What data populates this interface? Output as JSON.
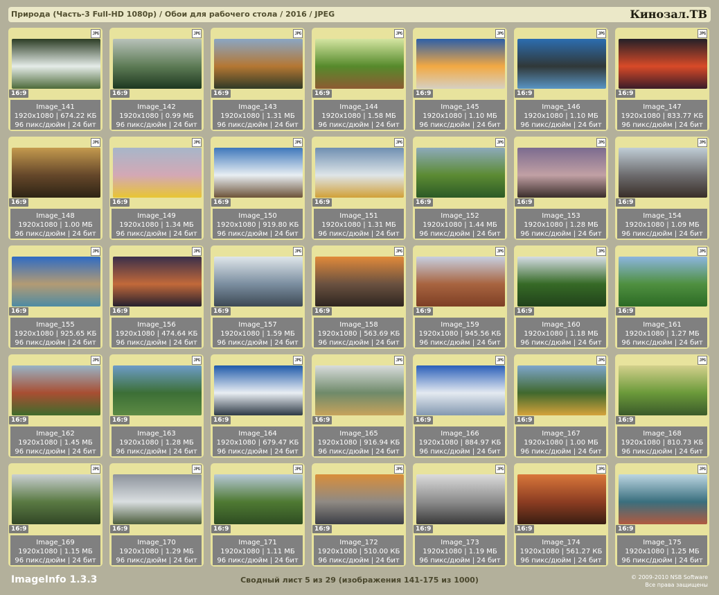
{
  "header": {
    "title": "Природа (Часть-3 Full-HD 1080p) / Обои для рабочего стола / 2016 / JPEG",
    "brand": "Кинозал.ТВ"
  },
  "card_badge": "JPG",
  "items": [
    {
      "name": "Image_141",
      "dims": "1920x1080 | 674.22 КБ",
      "meta": "96 пикс/дюйм | 24 бит",
      "ratio": "16:9",
      "colors": [
        "#2c3d25",
        "#e5ece8",
        "#4d6a3a"
      ]
    },
    {
      "name": "Image_142",
      "dims": "1920x1080 | 0.99 МБ",
      "meta": "96 пикс/дюйм | 24 бит",
      "ratio": "16:9",
      "colors": [
        "#b8c2ba",
        "#5d7b55",
        "#1d3820"
      ]
    },
    {
      "name": "Image_143",
      "dims": "1920x1080 | 1.31 МБ",
      "meta": "96 пикс/дюйм | 24 бит",
      "ratio": "16:9",
      "colors": [
        "#8aa6c4",
        "#b47733",
        "#303a26"
      ]
    },
    {
      "name": "Image_144",
      "dims": "1920x1080 | 1.58 МБ",
      "meta": "96 пикс/дюйм | 24 бит",
      "ratio": "16:9",
      "colors": [
        "#d4e5a1",
        "#568a2c",
        "#8d5b32"
      ]
    },
    {
      "name": "Image_145",
      "dims": "1920x1080 | 1.10 МБ",
      "meta": "96 пикс/дюйм | 24 бит",
      "ratio": "16:9",
      "colors": [
        "#2c5fa8",
        "#f2a943",
        "#d6d0c2"
      ]
    },
    {
      "name": "Image_146",
      "dims": "1920x1080 | 1.10 МБ",
      "meta": "96 пикс/дюйм | 24 бит",
      "ratio": "16:9",
      "colors": [
        "#2c6db0",
        "#303838",
        "#5995c4"
      ]
    },
    {
      "name": "Image_147",
      "dims": "1920x1080 | 833.77 КБ",
      "meta": "96 пикс/дюйм | 24 бит",
      "ratio": "16:9",
      "colors": [
        "#232028",
        "#d84a28",
        "#3a1c28"
      ]
    },
    {
      "name": "Image_148",
      "dims": "1920x1080 | 1.00 МБ",
      "meta": "96 пикс/дюйм | 24 бит",
      "ratio": "16:9",
      "colors": [
        "#c49a4e",
        "#65472a",
        "#2e2414"
      ]
    },
    {
      "name": "Image_149",
      "dims": "1920x1080 | 1.34 МБ",
      "meta": "96 пикс/дюйм | 24 бит",
      "ratio": "16:9",
      "colors": [
        "#a7b6c9",
        "#d3a8b5",
        "#e8c533"
      ]
    },
    {
      "name": "Image_150",
      "dims": "1920x1080 | 919.80 КБ",
      "meta": "96 пикс/дюйм | 24 бит",
      "ratio": "16:9",
      "colors": [
        "#3e78bb",
        "#e8eef3",
        "#6c5338"
      ]
    },
    {
      "name": "Image_151",
      "dims": "1920x1080 | 1.31 МБ",
      "meta": "96 пикс/дюйм | 24 бит",
      "ratio": "16:9",
      "colors": [
        "#6f8fb1",
        "#dee5e8",
        "#d1a038"
      ]
    },
    {
      "name": "Image_152",
      "dims": "1920x1080 | 1.44 МБ",
      "meta": "96 пикс/дюйм | 24 бит",
      "ratio": "16:9",
      "colors": [
        "#8daabb",
        "#5c8b33",
        "#2c5a26"
      ]
    },
    {
      "name": "Image_153",
      "dims": "1920x1080 | 1.28 МБ",
      "meta": "96 пикс/дюйм | 24 бит",
      "ratio": "16:9",
      "colors": [
        "#7b6b8f",
        "#c1a0a4",
        "#3a2d2a"
      ]
    },
    {
      "name": "Image_154",
      "dims": "1920x1080 | 1.09 МБ",
      "meta": "96 пикс/дюйм | 24 бит",
      "ratio": "16:9",
      "colors": [
        "#c0cdd6",
        "#6d6c6e",
        "#392e28"
      ]
    },
    {
      "name": "Image_155",
      "dims": "1920x1080 | 925.65 КБ",
      "meta": "96 пикс/дюйм | 24 бит",
      "ratio": "16:9",
      "colors": [
        "#2f6bc3",
        "#b39b74",
        "#4e8ba3"
      ]
    },
    {
      "name": "Image_156",
      "dims": "1920x1080 | 474.64 КБ",
      "meta": "96 пикс/дюйм | 24 бит",
      "ratio": "16:9",
      "colors": [
        "#3a2f4a",
        "#c2693a",
        "#26202e"
      ]
    },
    {
      "name": "Image_157",
      "dims": "1920x1080 | 1.59 МБ",
      "meta": "96 пикс/дюйм | 24 бит",
      "ratio": "16:9",
      "colors": [
        "#dfe6ea",
        "#7b8ea0",
        "#3d4954"
      ]
    },
    {
      "name": "Image_158",
      "dims": "1920x1080 | 563.69 КБ",
      "meta": "96 пикс/дюйм | 24 бит",
      "ratio": "16:9",
      "colors": [
        "#e18a3a",
        "#6a5140",
        "#2f2620"
      ]
    },
    {
      "name": "Image_159",
      "dims": "1920x1080 | 945.56 КБ",
      "meta": "96 пикс/дюйм | 24 бит",
      "ratio": "16:9",
      "colors": [
        "#c7cfe1",
        "#a86440",
        "#7d3f25"
      ]
    },
    {
      "name": "Image_160",
      "dims": "1920x1080 | 1.18 МБ",
      "meta": "96 пикс/дюйм | 24 бит",
      "ratio": "16:9",
      "colors": [
        "#d5dce5",
        "#366a26",
        "#21421b"
      ]
    },
    {
      "name": "Image_161",
      "dims": "1920x1080 | 1.27 МБ",
      "meta": "96 пикс/дюйм | 24 бит",
      "ratio": "16:9",
      "colors": [
        "#8cb5df",
        "#4f9040",
        "#2c6a25"
      ]
    },
    {
      "name": "Image_162",
      "dims": "1920x1080 | 1.45 МБ",
      "meta": "96 пикс/дюйм | 24 бит",
      "ratio": "16:9",
      "colors": [
        "#98b3c6",
        "#a84e32",
        "#3f6b2c"
      ]
    },
    {
      "name": "Image_163",
      "dims": "1920x1080 | 1.28 МБ",
      "meta": "96 пикс/дюйм | 24 бит",
      "ratio": "16:9",
      "colors": [
        "#6d9cc8",
        "#3c6f36",
        "#5c8a44"
      ]
    },
    {
      "name": "Image_164",
      "dims": "1920x1080 | 679.47 КБ",
      "meta": "96 пикс/дюйм | 24 бит",
      "ratio": "16:9",
      "colors": [
        "#1f5aaa",
        "#e9eef3",
        "#2e3a46"
      ]
    },
    {
      "name": "Image_165",
      "dims": "1920x1080 | 916.94 КБ",
      "meta": "96 пикс/дюйм | 24 бит",
      "ratio": "16:9",
      "colors": [
        "#d8dcdc",
        "#6f8a6a",
        "#c7a35c"
      ]
    },
    {
      "name": "Image_166",
      "dims": "1920x1080 | 884.97 КБ",
      "meta": "96 пикс/дюйм | 24 бит",
      "ratio": "16:9",
      "colors": [
        "#2a5fb9",
        "#e4eaf1",
        "#8398b0"
      ]
    },
    {
      "name": "Image_167",
      "dims": "1920x1080 | 1.00 МБ",
      "meta": "96 пикс/дюйм | 24 бит",
      "ratio": "16:9",
      "colors": [
        "#7ea6cc",
        "#40682d",
        "#d5a33b"
      ]
    },
    {
      "name": "Image_168",
      "dims": "1920x1080 | 810.73 КБ",
      "meta": "96 пикс/дюйм | 24 бит",
      "ratio": "16:9",
      "colors": [
        "#d3d08c",
        "#6b9a3a",
        "#3b5a2a"
      ]
    },
    {
      "name": "Image_169",
      "dims": "1920x1080 | 1.15 МБ",
      "meta": "96 пикс/дюйм | 24 бит",
      "ratio": "16:9",
      "colors": [
        "#c9cfd2",
        "#5a7a43",
        "#324626"
      ]
    },
    {
      "name": "Image_170",
      "dims": "1920x1080 | 1.29 МБ",
      "meta": "96 пикс/дюйм | 24 бит",
      "ratio": "16:9",
      "colors": [
        "#8d939c",
        "#d9dee0",
        "#4c5d3d"
      ]
    },
    {
      "name": "Image_171",
      "dims": "1920x1080 | 1.11 МБ",
      "meta": "96 пикс/дюйм | 24 бит",
      "ratio": "16:9",
      "colors": [
        "#b7c9d8",
        "#4f7a33",
        "#2f4d22"
      ]
    },
    {
      "name": "Image_172",
      "dims": "1920x1080 | 510.00 КБ",
      "meta": "96 пикс/дюйм | 24 бит",
      "ratio": "16:9",
      "colors": [
        "#d98e3a",
        "#8f8a84",
        "#3c3e45"
      ]
    },
    {
      "name": "Image_173",
      "dims": "1920x1080 | 1.19 МБ",
      "meta": "96 пикс/дюйм | 24 бит",
      "ratio": "16:9",
      "colors": [
        "#dcdcdc",
        "#8c8c8c",
        "#3a3a3a"
      ]
    },
    {
      "name": "Image_174",
      "dims": "1920x1080 | 561.27 КБ",
      "meta": "96 пикс/дюйм | 24 бит",
      "ratio": "16:9",
      "colors": [
        "#d9773a",
        "#8c3d22",
        "#3a1e12"
      ]
    },
    {
      "name": "Image_175",
      "dims": "1920x1080 | 1.25 МБ",
      "meta": "96 пикс/дюйм | 24 бит",
      "ratio": "16:9",
      "colors": [
        "#bcd6e2",
        "#3a6f7e",
        "#b05a40"
      ]
    }
  ],
  "footer": {
    "app_name": "ImageInfo 1.3.3",
    "sheet_info": "Сводный лист 5 из 29 (изображения 141-175 из 1000)",
    "copyright": "© 2009-2010 NSB Software",
    "rights": "Все права защищены"
  }
}
